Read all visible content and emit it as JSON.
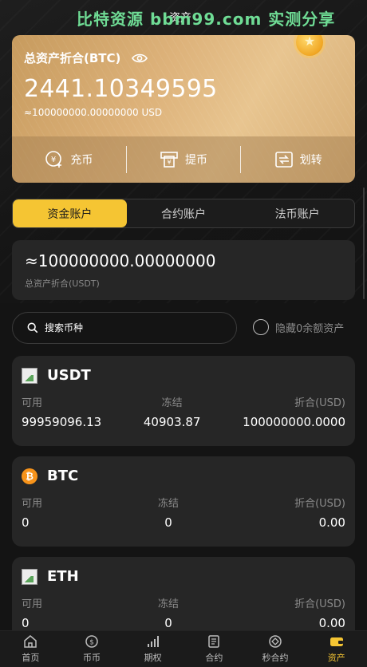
{
  "watermark": "比特资源 bbm99.com 实测分享",
  "page_title": "资产",
  "asset_card": {
    "label": "总资产折合(BTC)",
    "amount": "2441.10349595",
    "sub": "≈100000000.00000000 USD",
    "actions": [
      {
        "label": "充币",
        "icon": "deposit-icon"
      },
      {
        "label": "提币",
        "icon": "withdraw-icon"
      },
      {
        "label": "划转",
        "icon": "transfer-icon"
      }
    ]
  },
  "tabs": [
    {
      "label": "资金账户",
      "active": true
    },
    {
      "label": "合约账户",
      "active": false
    },
    {
      "label": "法币账户",
      "active": false
    }
  ],
  "total": {
    "value": "≈100000000.00000000",
    "label": "总资产折合(USDT)"
  },
  "search": {
    "placeholder": "搜索币种",
    "hide_zero_label": "隐藏0余额资产"
  },
  "coins": [
    {
      "name": "USDT",
      "icon": "broken-image-icon",
      "col1_h": "可用",
      "col2_h": "冻结",
      "col3_h": "折合(USD)",
      "available": "99959096.13",
      "frozen": "40903.87",
      "converted": "100000000.0000"
    },
    {
      "name": "BTC",
      "icon": "bitcoin-icon",
      "col1_h": "可用",
      "col2_h": "冻结",
      "col3_h": "折合(USD)",
      "available": "0",
      "frozen": "0",
      "converted": "0.00"
    },
    {
      "name": "ETH",
      "icon": "broken-image-icon",
      "col1_h": "可用",
      "col2_h": "冻结",
      "col3_h": "折合(USD)",
      "available": "0",
      "frozen": "0",
      "converted": "0.00"
    }
  ],
  "bottom_nav": [
    {
      "label": "首页",
      "icon": "home-icon"
    },
    {
      "label": "币币",
      "icon": "coin-icon"
    },
    {
      "label": "期权",
      "icon": "bars-icon"
    },
    {
      "label": "合约",
      "icon": "document-icon"
    },
    {
      "label": "秒合约",
      "icon": "target-icon"
    },
    {
      "label": "资产",
      "icon": "wallet-icon",
      "active": true
    }
  ],
  "colors": {
    "accent": "#f5c533",
    "card_gold": "#ddb27a",
    "background": "#141414",
    "watermark": "#6fdc95"
  }
}
